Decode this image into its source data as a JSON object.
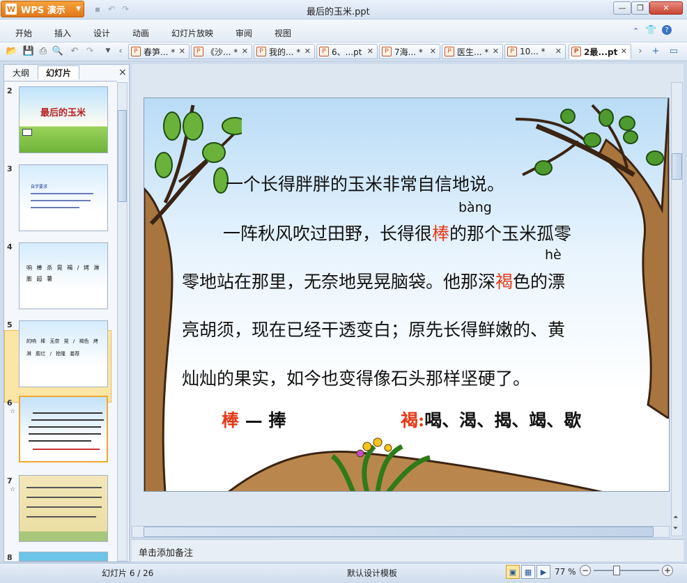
{
  "app": {
    "brand": "WPS 演示",
    "window_title": "最后的玉米.ppt"
  },
  "menu": [
    "开始",
    "插入",
    "设计",
    "动画",
    "幻灯片放映",
    "审阅",
    "视图"
  ],
  "doc_tabs": [
    {
      "label": "春笋... *",
      "active": false
    },
    {
      "label": "《沙... *",
      "active": false
    },
    {
      "label": "我的... *",
      "active": false
    },
    {
      "label": "6、...pt",
      "active": false
    },
    {
      "label": "7海... *",
      "active": false
    },
    {
      "label": "医生... *",
      "active": false
    },
    {
      "label": "10... *",
      "active": false
    },
    {
      "label": "2最...pt",
      "active": true
    }
  ],
  "panel": {
    "tab_outline": "大纲",
    "tab_slides": "幻灯片",
    "close": "×",
    "thumbnails": [
      {
        "num": "2",
        "title": "最后的玉米"
      },
      {
        "num": "3",
        "title": "自学要求"
      },
      {
        "num": "4",
        "chars": "响 棒 杀 晃 褐 / 烤 淋 膨 超 薯"
      },
      {
        "num": "5",
        "chars": "的响 棒 无奈 晃 / 褐色 烤 淋 膨烂 / 抢隆 娄荐"
      },
      {
        "num": "6",
        "selected": true
      },
      {
        "num": "7"
      },
      {
        "num": "8"
      }
    ]
  },
  "slide": {
    "line1": "一个长得胖胖的玉米非常自信地说。",
    "pinyin1": "bàng",
    "line2_a": "一阵秋风吹过田野，长得很",
    "line2_red": "棒",
    "line2_b": "的那个玉米孤零",
    "pinyin2": "hè",
    "line3_a": "零地站在那里，无奈地晃晃脑袋。他那深",
    "line3_red": "褐",
    "line3_b": "色的漂",
    "line4": "亮胡须，现在已经干透变白；原先长得鲜嫩的、黄",
    "line5": "灿灿的果实，如今也变得像石头那样坚硬了。",
    "word1_red": "棒",
    "word1_dash": "—",
    "word1_b": "捧",
    "word2_red": "褐:",
    "word2_list": "喝、渴、揭、竭、歇"
  },
  "notes_placeholder": "单击添加备注",
  "status": {
    "slide_counter": "幻灯片 6 / 26",
    "template": "默认设计模板",
    "zoom": "77 %"
  },
  "colors": {
    "accent_orange": "#e1771b",
    "red_text": "#e53a16",
    "chrome_blue": "#cfdceb"
  }
}
